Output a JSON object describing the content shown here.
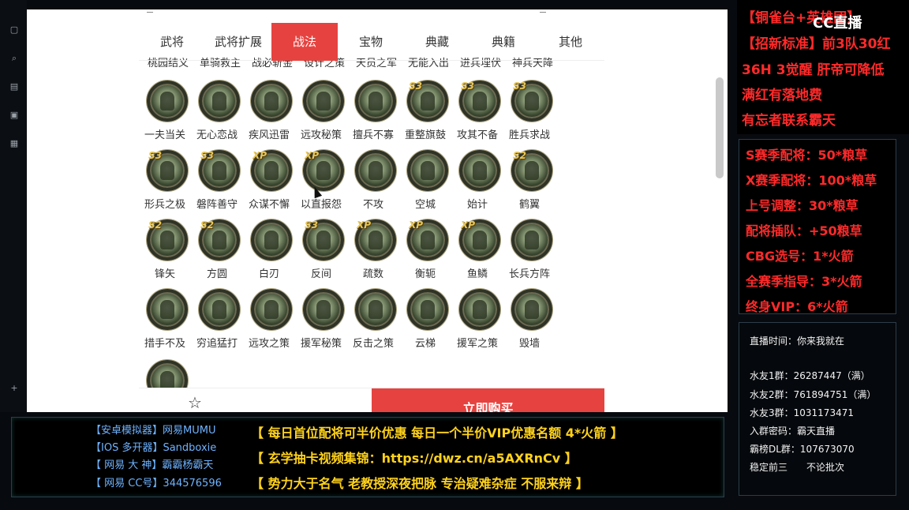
{
  "tabs": [
    {
      "label": "武将"
    },
    {
      "label": "武将扩展"
    },
    {
      "label": "战法"
    },
    {
      "label": "宝物"
    },
    {
      "label": "典藏"
    },
    {
      "label": "典籍"
    },
    {
      "label": "其他"
    }
  ],
  "partial_row": [
    "桃园结义",
    "单骑救主",
    "战必斩金",
    "设计之策",
    "天员之军",
    "无能入出",
    "进兵埋伏",
    "神兵天降"
  ],
  "skills": [
    [
      {
        "name": "一夫当关",
        "badge": ""
      },
      {
        "name": "无心恋战",
        "badge": ""
      },
      {
        "name": "疾风迅雷",
        "badge": ""
      },
      {
        "name": "远攻秘策",
        "badge": ""
      },
      {
        "name": "擅兵不寡",
        "badge": ""
      },
      {
        "name": "重整旗鼓",
        "badge": "S3"
      },
      {
        "name": "攻其不备",
        "badge": "S3"
      },
      {
        "name": "胜兵求战",
        "badge": "S3"
      }
    ],
    [
      {
        "name": "形兵之极",
        "badge": "S3"
      },
      {
        "name": "磐阵善守",
        "badge": "S3"
      },
      {
        "name": "众谋不懈",
        "badge": "XP"
      },
      {
        "name": "以直报怨",
        "badge": "XP"
      },
      {
        "name": "不攻",
        "badge": ""
      },
      {
        "name": "空城",
        "badge": ""
      },
      {
        "name": "始计",
        "badge": ""
      },
      {
        "name": "鹤翼",
        "badge": "S2"
      }
    ],
    [
      {
        "name": "锋矢",
        "badge": "S2"
      },
      {
        "name": "方圆",
        "badge": "S2"
      },
      {
        "name": "白刃",
        "badge": ""
      },
      {
        "name": "反间",
        "badge": "S3"
      },
      {
        "name": "疏数",
        "badge": "XP"
      },
      {
        "name": "衡轭",
        "badge": "XP"
      },
      {
        "name": "鱼鳞",
        "badge": "XP"
      },
      {
        "name": "长兵方阵",
        "badge": ""
      }
    ],
    [
      {
        "name": "措手不及",
        "badge": ""
      },
      {
        "name": "穷追猛打",
        "badge": ""
      },
      {
        "name": "远攻之策",
        "badge": ""
      },
      {
        "name": "援军秘策",
        "badge": ""
      },
      {
        "name": "反击之策",
        "badge": ""
      },
      {
        "name": "云梯",
        "badge": ""
      },
      {
        "name": "援军之策",
        "badge": ""
      },
      {
        "name": "毁墙",
        "badge": ""
      }
    ]
  ],
  "bottom": {
    "buy_label": "立即购买"
  },
  "right_top": {
    "logo": "CC直播",
    "lines": [
      "【铜雀台+英雄团】",
      "【招新标准】前3队30红",
      "36H 3觉醒 肝帝可降低",
      "满红有落地费",
      "有忘者联系霸天"
    ]
  },
  "right_mid": {
    "lines": [
      "S赛季配将：50*粮草",
      "X赛季配将：100*粮草",
      "上号调整：30*粮草",
      "配将插队：+50粮草",
      "CBG选号：1*火箭",
      "全赛季指导：3*火箭",
      "终身VIP：6*火箭"
    ]
  },
  "right_bot": {
    "lines": [
      "直播时间：你来我就在",
      "",
      "水友1群：26287447（满）",
      "水友2群：761894751（满）",
      "水友3群：1031173471",
      "入群密码：霸天直播",
      "霸榜DL群：107673070",
      "稳定前三　　不论批次"
    ]
  },
  "banner": {
    "left": [
      "【安卓模拟器】网易MUMU",
      "【IOS 多开器】Sandboxie",
      "【 网易 大 神】霸霸杨霸天",
      "【 网易 CC号】344576596"
    ],
    "right": [
      "【  每日首位配将可半价优惠  每日一个半价VIP优惠名额  4*火箭  】",
      "【          玄学抽卡视频集锦：https://dwz.cn/a5AXRnCv          】",
      "【   势力大于名气   老教授深夜把脉    专治疑难杂症    不服来辩    】"
    ]
  },
  "colors": {
    "accent": "#e64340",
    "red_text": "#ff2a2a",
    "yellow_text": "#ffd21c",
    "blue_text": "#6fb3ff"
  }
}
